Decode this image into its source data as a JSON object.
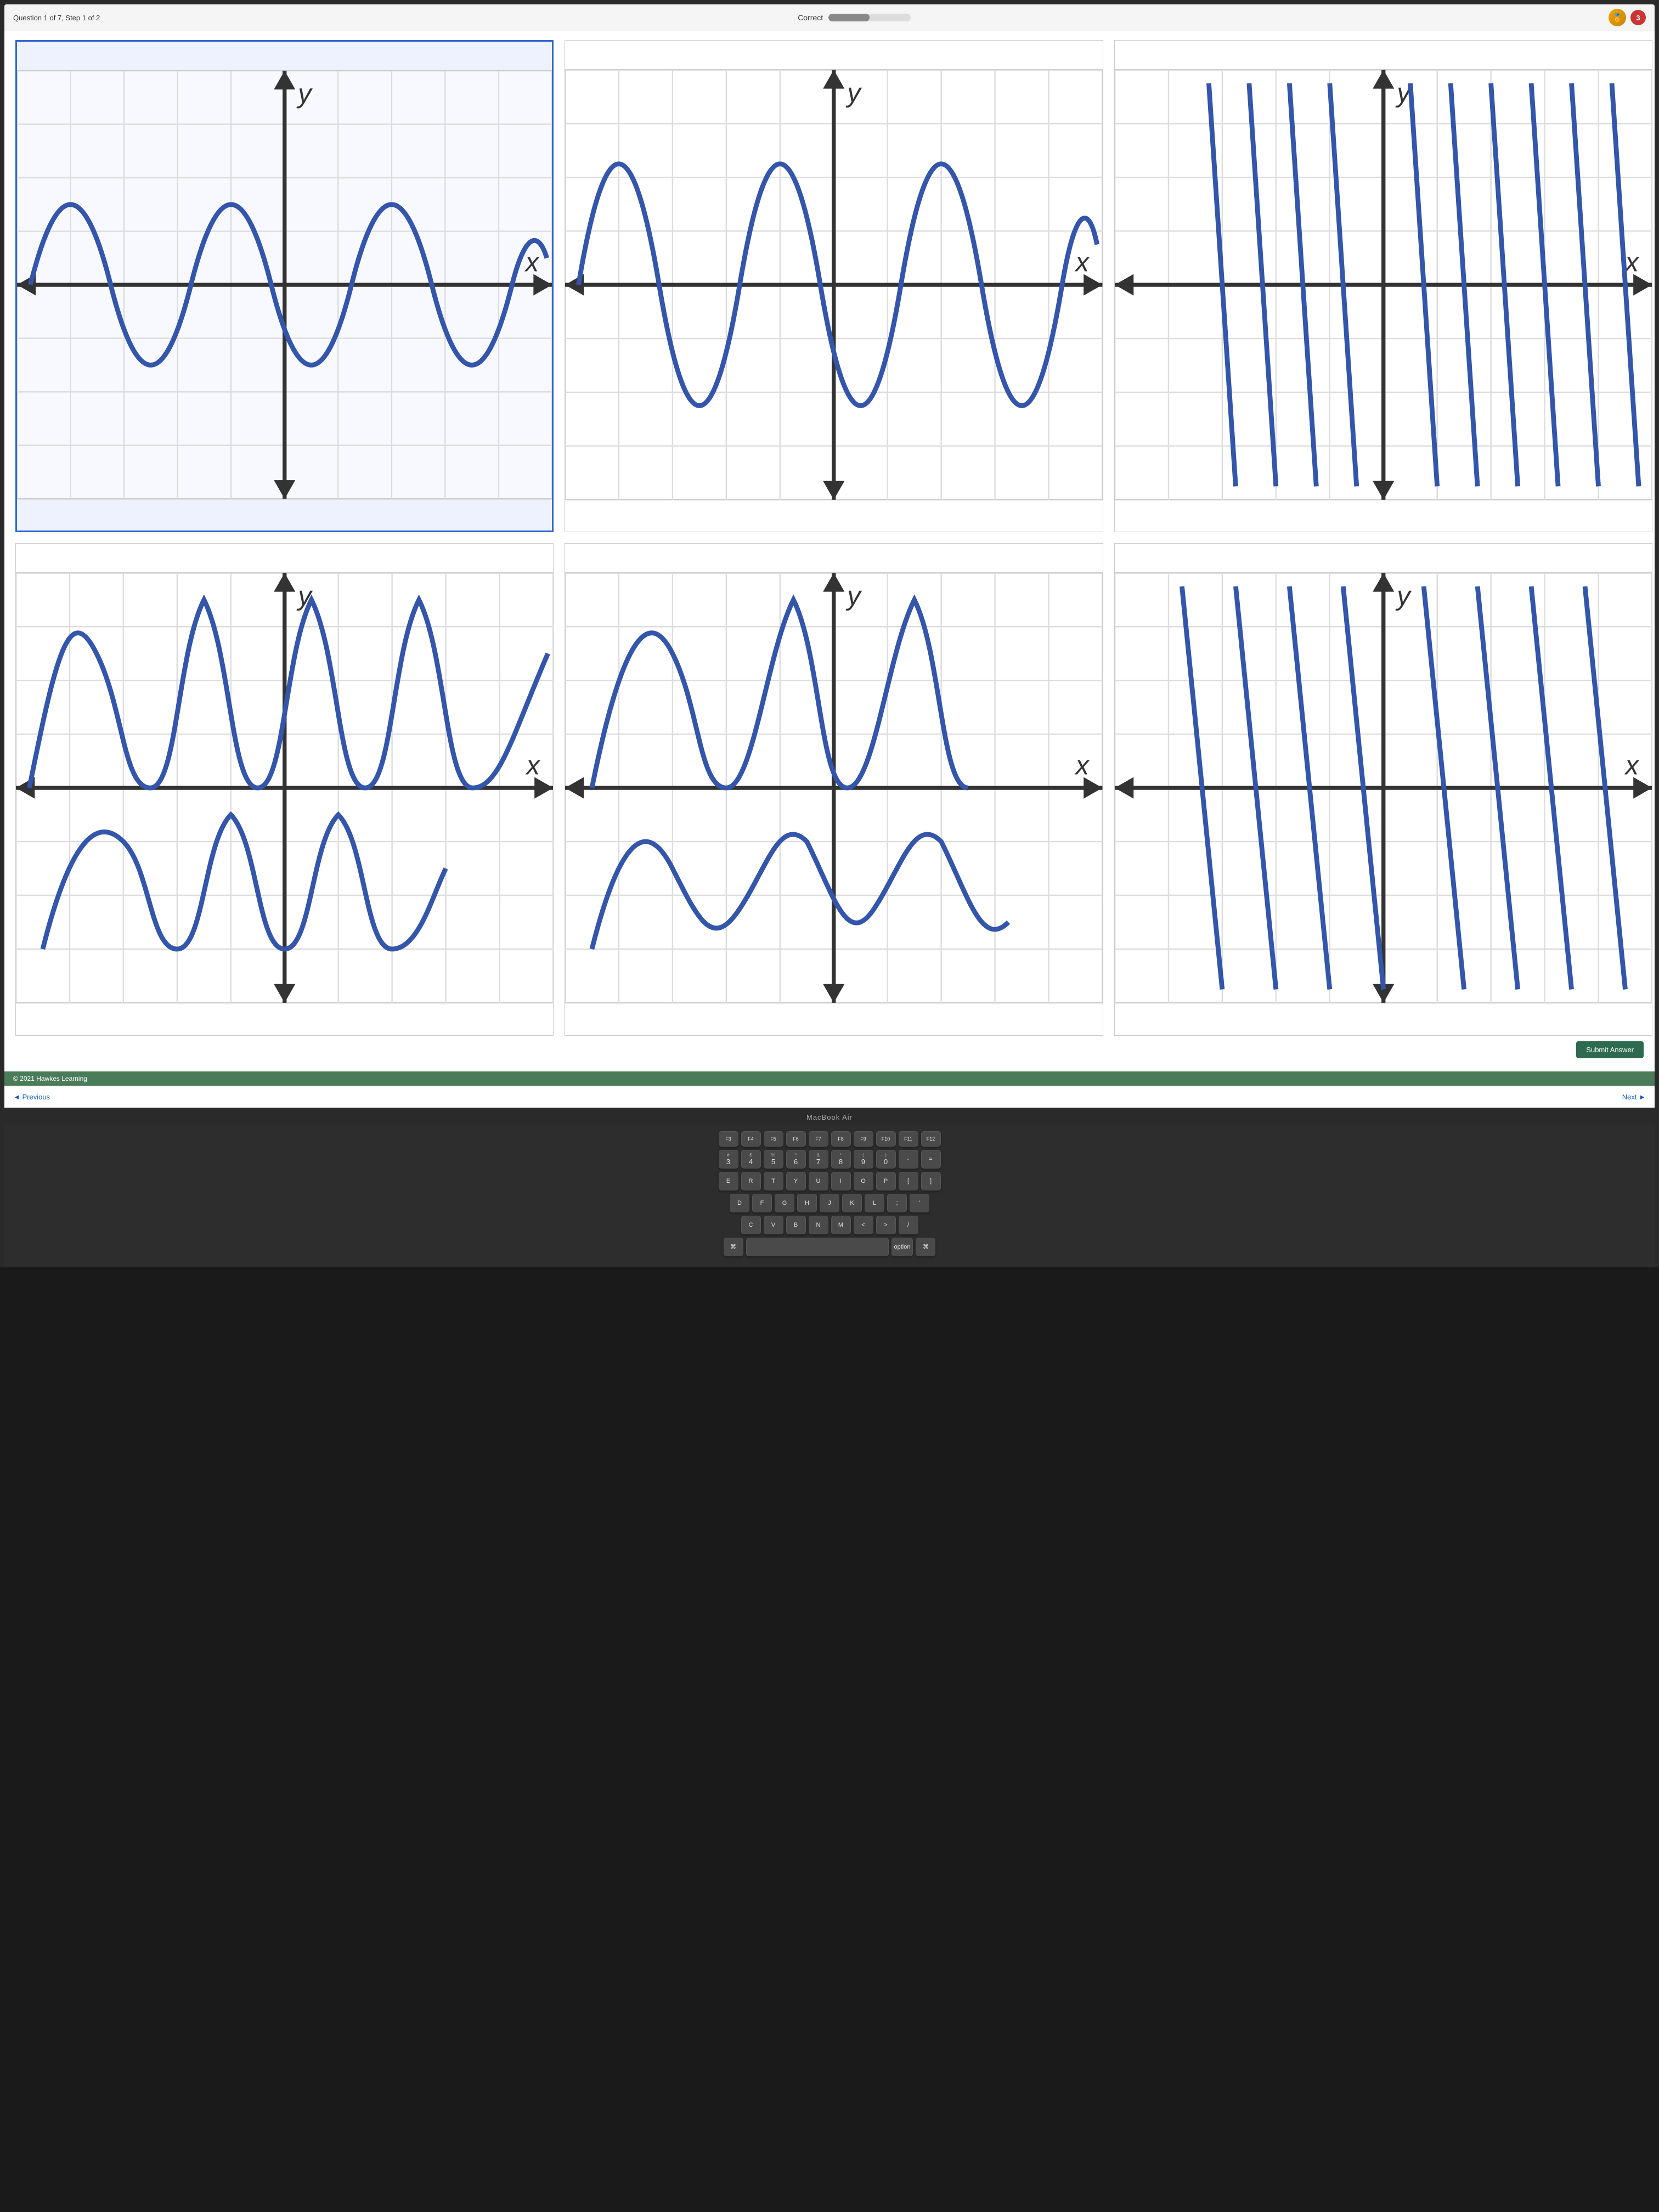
{
  "header": {
    "question_info": "Question 1 of 7, Step 1 of 2",
    "correct_label": "Correct",
    "coin_icon": "🪙",
    "badge_number": "3"
  },
  "graphs": {
    "row1": [
      {
        "id": "graph-1",
        "selected": true,
        "type": "sine_wave"
      },
      {
        "id": "graph-2",
        "selected": false,
        "type": "sine_wave_tall"
      },
      {
        "id": "graph-3",
        "selected": false,
        "type": "vertical_lines"
      }
    ],
    "row2": [
      {
        "id": "graph-4",
        "selected": false,
        "type": "u_shape"
      },
      {
        "id": "graph-5",
        "selected": false,
        "type": "u_shape_2"
      },
      {
        "id": "graph-6",
        "selected": false,
        "type": "vertical_lines_2"
      }
    ]
  },
  "buttons": {
    "submit": "Submit Answer",
    "previous": "◄ Previous",
    "next": "Next ►"
  },
  "copyright": "© 2021 Hawkes Learning",
  "macbook_label": "MacBook Air",
  "keyboard": {
    "fn_row": [
      "F3",
      "F4",
      "F5",
      "F6",
      "F7",
      "F8",
      "F9",
      "F10",
      "F11",
      "F12"
    ],
    "row1": [
      "#\n3",
      "$\n4",
      "%\n5",
      "^\n6",
      "&\n7",
      "*\n8",
      "(\n9",
      ")\n0",
      "-",
      "="
    ],
    "row2": [
      "E",
      "R",
      "T",
      "Y",
      "U",
      "I",
      "O",
      "P",
      "[",
      "]"
    ],
    "row3": [
      "D",
      "F",
      "G",
      "H",
      "J",
      "K",
      "L",
      ";",
      "'"
    ],
    "row4": [
      "C",
      "V",
      "B",
      "N",
      "M",
      "<",
      ">",
      "/"
    ]
  }
}
